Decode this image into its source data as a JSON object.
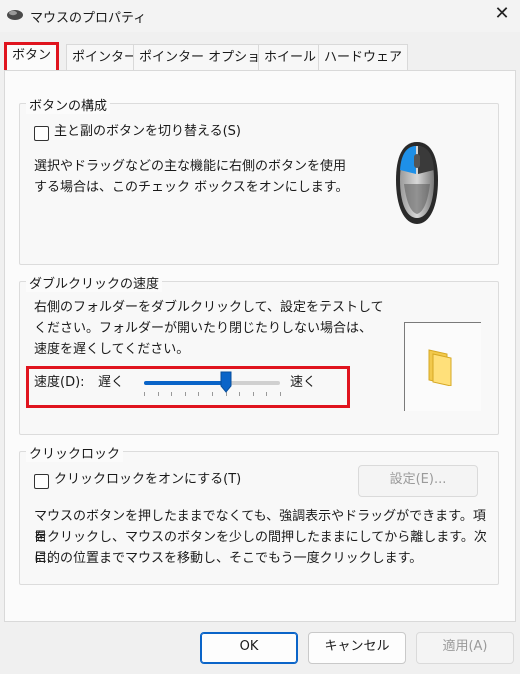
{
  "window": {
    "title": "マウスのプロパティ"
  },
  "tabs": [
    "ボタン",
    "ポインター",
    "ポインター オプション",
    "ホイール",
    "ハードウェア"
  ],
  "button_config": {
    "title": "ボタンの構成",
    "swap_label": "主と副のボタンを切り替える(S)",
    "swap_checked": false,
    "desc_line1": "選択やドラッグなどの主な機能に右側のボタンを使用",
    "desc_line2": "する場合は、このチェック ボックスをオンにします。"
  },
  "double_click": {
    "title": "ダブルクリックの速度",
    "desc_line1": "右側のフォルダーをダブルクリックして、設定をテストして",
    "desc_line2": "ください。フォルダーが開いたり閉じたりしない場合は、",
    "desc_line3": "速度を遅くしてください。",
    "speed_label": "速度(D):",
    "slow_label": "遅く",
    "fast_label": "速く",
    "speed_value": 0.6
  },
  "click_lock": {
    "title": "クリックロック",
    "enable_label": "クリックロックをオンにする(T)",
    "enable_checked": false,
    "settings_button": "設定(E)...",
    "desc_line1": "マウスのボタンを押したままでなくても、強調表示やドラッグができます。項目",
    "desc_line2": "をクリックし、マウスのボタンを少しの間押したままにしてから離します。次に、",
    "desc_line3": "目的の位置までマウスを移動し、そこでもう一度クリックします。"
  },
  "footer": {
    "ok": "OK",
    "cancel": "キャンセル",
    "apply": "適用(A)"
  },
  "colors": {
    "accent": "#0a64c8",
    "highlight": "#e0141e"
  },
  "icons": {
    "window": "mouse-app-icon",
    "close": "close-icon",
    "mouse": "mouse-illustration",
    "folder": "folder-icon"
  }
}
